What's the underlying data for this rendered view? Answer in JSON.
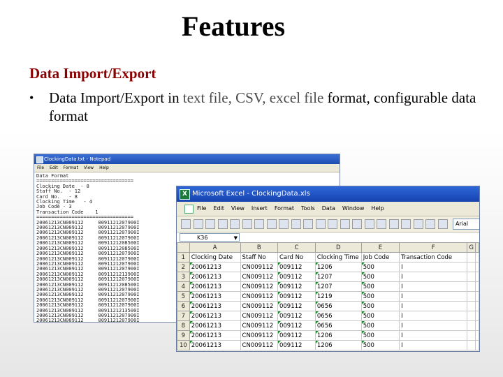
{
  "slide": {
    "title": "Features",
    "section_heading": "Data Import/Export",
    "bullet": {
      "marker": "•",
      "part1": "Data Import/Export in ",
      "part2": "text file, CSV, excel file",
      "part3": " format, configurable data format"
    }
  },
  "notepad": {
    "title": "ClockingData.txt - Notepad",
    "menu": [
      "File",
      "Edit",
      "Format",
      "View",
      "Help"
    ],
    "lines": [
      "Data Format",
      "=================================",
      "Clocking Date  - 8",
      "Staff No.  - 12",
      "Card No.   - 8",
      "Clocking Time   - 4",
      "Job Code - 3",
      "Transaction Code    1",
      "=================================",
      "20061213CN009112     0091121207900I",
      "20061213CN009112     0091121207900I",
      "20061213CN009112     0091121207900I",
      "20061213CN009112     0091121207900I",
      "20061213CN009112     0091121208500I",
      "20061213CN009112     0091121208500I",
      "20061213CN009112     0091121207900I",
      "20061213CN009112     0091121207900I",
      "20061213CN009112     0091121207900I",
      "20061213CN009112     0091121207900I",
      "20061213CN009112     0091121213900I",
      "20061213CN009112     0091121207900I",
      "20061213CN009112     0091121208500I",
      "20061213CN009112     0091121207900I",
      "20061213CN009112     0091121207900I",
      "20061213CN009112     0091121207900I",
      "20061213CN009112     0091121207900I",
      "20061213CN009112     0091121213500I",
      "20061213CN009112     0091121207900I",
      "20061213CN009112     0091121207900I",
      "20061213CN009112     0091121207900I",
      "20061213CN009112     0091121207900I"
    ]
  },
  "excel": {
    "title": "Microsoft Excel - ClockingData.xls",
    "app_icon": "X",
    "menu": [
      "File",
      "Edit",
      "View",
      "Insert",
      "Format",
      "Tools",
      "Data",
      "Window",
      "Help"
    ],
    "font_name": "Arial",
    "name_box": "K36",
    "name_box_arrow": "▼",
    "columns": [
      "A",
      "B",
      "C",
      "D",
      "E",
      "F",
      "G"
    ],
    "header_row": {
      "num": "1",
      "cells": [
        "Clocking Date",
        "Staff No",
        "Card No",
        "Clocking Time",
        "Job Code",
        "Transaction Code",
        ""
      ]
    },
    "rows": [
      {
        "num": "2",
        "cells": [
          "20061213",
          "CN009112",
          "009112",
          "1206",
          "500",
          "I",
          ""
        ]
      },
      {
        "num": "3",
        "cells": [
          "20061213",
          "CN009112",
          "009112",
          "1207",
          "500",
          "I",
          ""
        ]
      },
      {
        "num": "4",
        "cells": [
          "20061213",
          "CN009112",
          "009112",
          "1207",
          "500",
          "I",
          ""
        ]
      },
      {
        "num": "5",
        "cells": [
          "20061213",
          "CN009112",
          "009112",
          "1219",
          "500",
          "I",
          ""
        ]
      },
      {
        "num": "6",
        "cells": [
          "20061213",
          "CN009112",
          "009112",
          "0656",
          "500",
          "I",
          ""
        ]
      },
      {
        "num": "7",
        "cells": [
          "20061213",
          "CN009112",
          "009112",
          "0656",
          "500",
          "I",
          ""
        ]
      },
      {
        "num": "8",
        "cells": [
          "20061213",
          "CN009112",
          "009112",
          "0656",
          "500",
          "I",
          ""
        ]
      },
      {
        "num": "9",
        "cells": [
          "20061213",
          "CN009112",
          "009112",
          "1206",
          "500",
          "I",
          ""
        ]
      },
      {
        "num": "10",
        "cells": [
          "20061213",
          "CN009112",
          "009112",
          "1206",
          "500",
          "I",
          ""
        ]
      }
    ]
  }
}
